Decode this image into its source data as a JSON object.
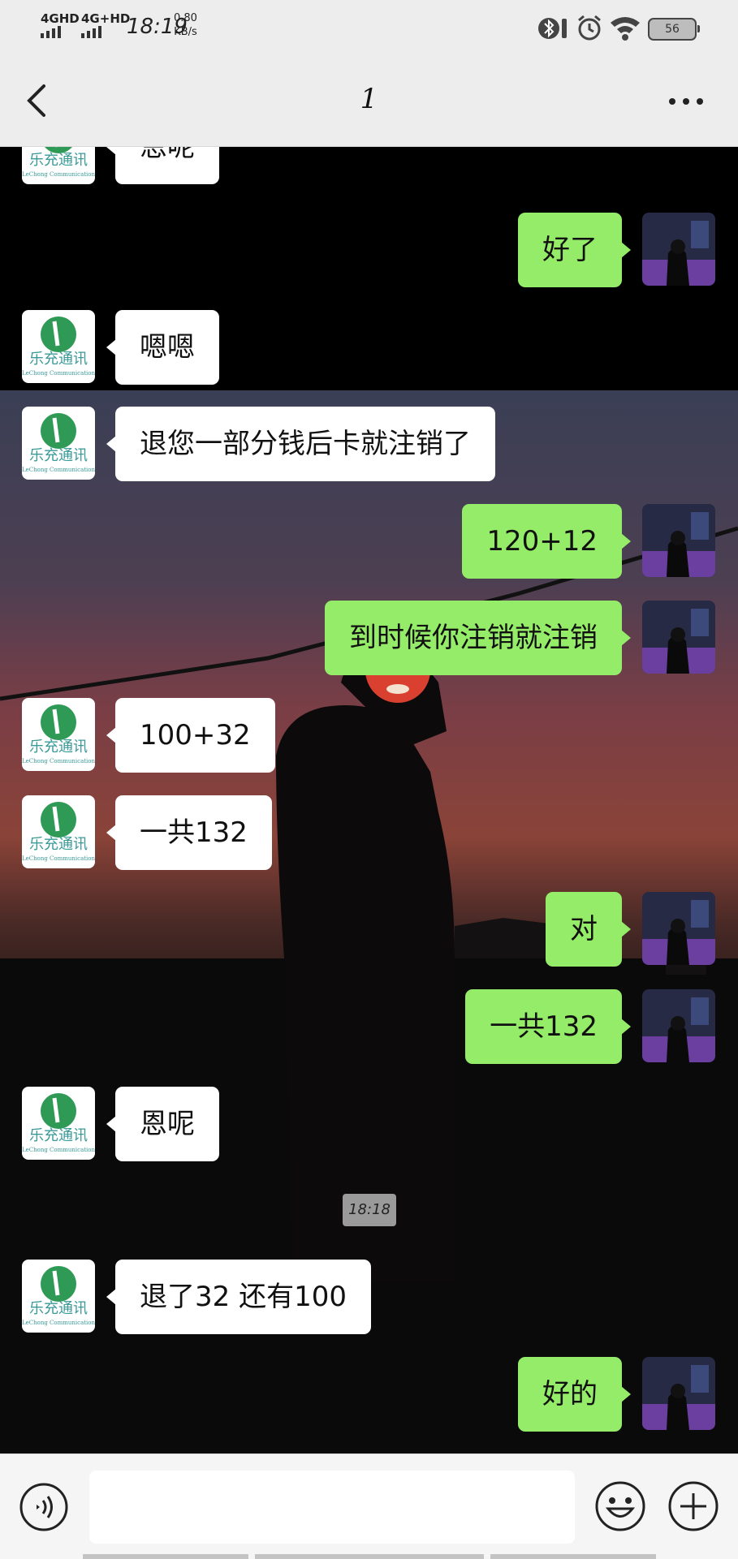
{
  "status_bar": {
    "network_1": "4GHD",
    "network_2": "4G+HD",
    "time": "18:19",
    "speed_value": "0.80",
    "speed_unit": "KB/s",
    "battery": "56"
  },
  "header": {
    "title": "1",
    "back_icon": "chevron-left-icon",
    "more_icon": "more-dots-icon"
  },
  "contact_avatar": {
    "name_cn": "乐充通讯",
    "name_en": "LeChong Communication",
    "colors": {
      "green": "#2f9a55",
      "teal": "#3a9a98"
    }
  },
  "messages": [
    {
      "side": "in",
      "text": "恩呢"
    },
    {
      "side": "out",
      "text": "好了"
    },
    {
      "side": "in",
      "text": "嗯嗯"
    },
    {
      "side": "in",
      "text": "退您一部分钱后卡就注销了"
    },
    {
      "side": "out",
      "text": "120+12"
    },
    {
      "side": "out",
      "text": "到时候你注销就注销"
    },
    {
      "side": "in",
      "text": "100+32"
    },
    {
      "side": "in",
      "text": "一共132"
    },
    {
      "side": "out",
      "text": "对"
    },
    {
      "side": "out",
      "text": "一共132"
    },
    {
      "side": "in",
      "text": "恩呢"
    },
    {
      "side": "in",
      "text": "退了32  还有100"
    },
    {
      "side": "out",
      "text": "好的"
    }
  ],
  "timestamp": "18:18",
  "input_bar": {
    "voice_icon": "voice-icon",
    "message_value": "",
    "emoji_icon": "emoji-icon",
    "plus_icon": "plus-icon"
  },
  "colors": {
    "outgoing_bubble": "#95ec69",
    "incoming_bubble": "#ffffff",
    "bar_background": "#ededed"
  }
}
